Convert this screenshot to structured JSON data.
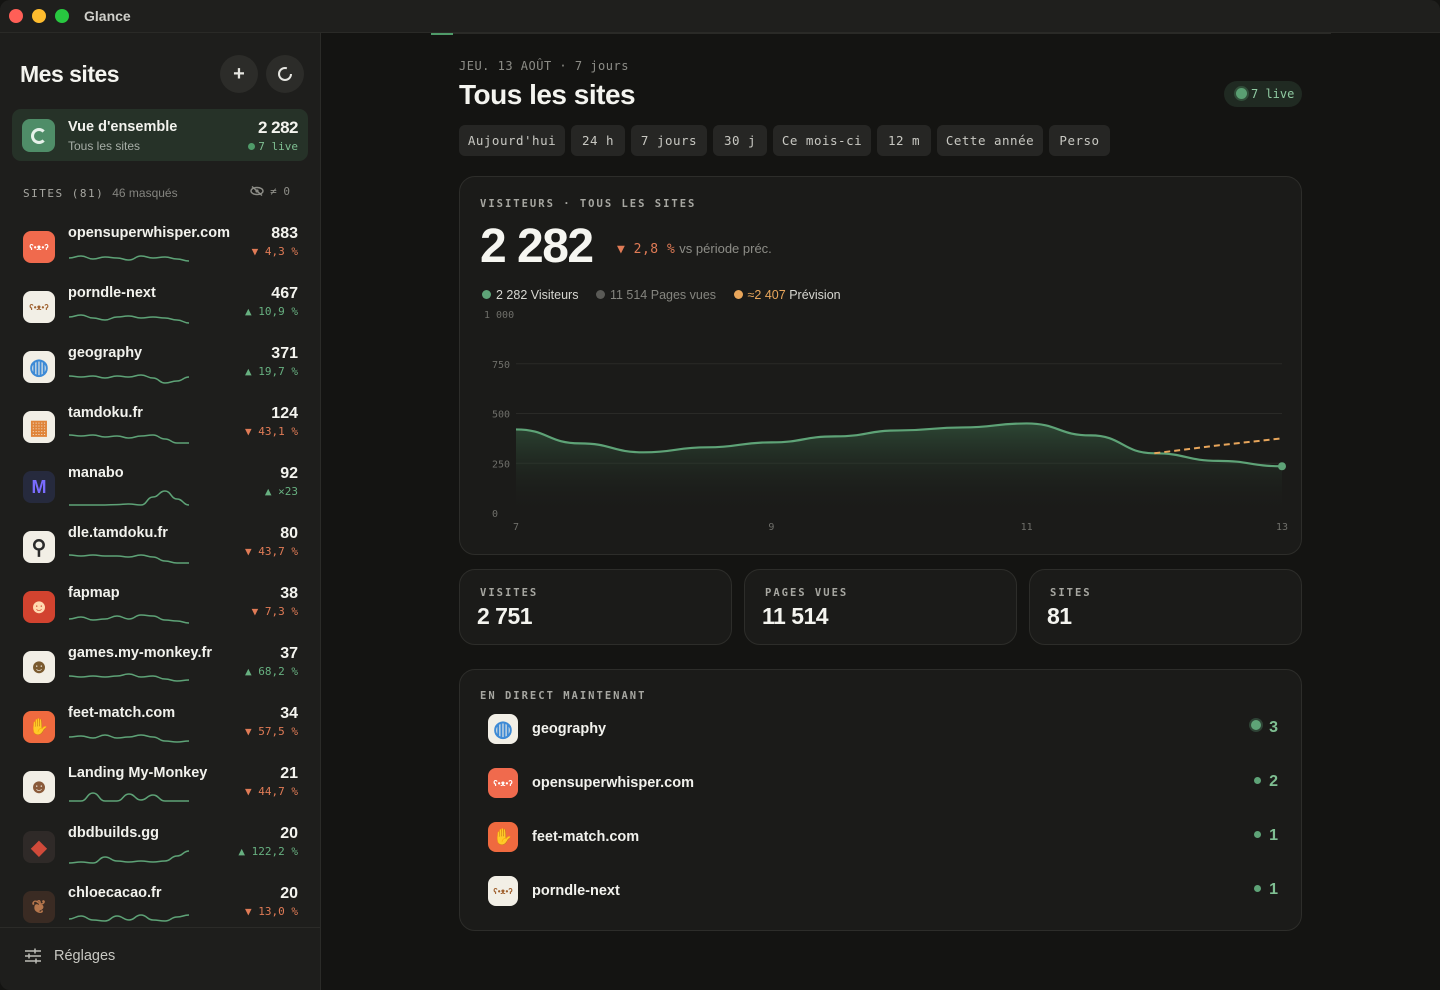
{
  "window": {
    "title": "Glance"
  },
  "sidebar": {
    "title": "Mes sites",
    "add_icon": "plus-icon",
    "refresh_icon": "refresh-icon",
    "overview": {
      "title": "Vue d'ensemble",
      "subtitle": "Tous les sites",
      "value": "2 282",
      "live": "7 live"
    },
    "sites_header": {
      "label": "SITES (81)",
      "hidden": "46 masqués",
      "filter": "≠ 0"
    },
    "sites": [
      {
        "name": "opensuperwhisper.com",
        "live": true,
        "value": "883",
        "delta": "▼ 4,3 %",
        "trend": "down",
        "icon": "bear-mic-icon",
        "icon_bg": "#f06a4d",
        "spark": [
          0.45,
          0.55,
          0.4,
          0.5,
          0.45,
          0.35,
          0.55,
          0.45,
          0.5,
          0.4,
          0.3
        ]
      },
      {
        "name": "porndle-next",
        "live": true,
        "value": "467",
        "delta": "▲ 10,9 %",
        "trend": "up",
        "icon": "bear-icon",
        "icon_bg": "#f2efe6",
        "spark": [
          0.5,
          0.6,
          0.45,
          0.35,
          0.5,
          0.55,
          0.45,
          0.5,
          0.45,
          0.35,
          0.2
        ]
      },
      {
        "name": "geography",
        "live": true,
        "value": "371",
        "delta": "▲ 19,7 %",
        "trend": "up",
        "icon": "globe-icon",
        "icon_bg": "#f2efe6",
        "spark": [
          0.55,
          0.5,
          0.55,
          0.45,
          0.55,
          0.5,
          0.6,
          0.45,
          0.2,
          0.3,
          0.5
        ]
      },
      {
        "name": "tamdoku.fr",
        "live": false,
        "value": "124",
        "delta": "▼ 43,1 %",
        "trend": "down",
        "icon": "grid-icon",
        "icon_bg": "#f2efe6",
        "spark": [
          0.6,
          0.55,
          0.6,
          0.5,
          0.55,
          0.45,
          0.55,
          0.6,
          0.4,
          0.2,
          0.2
        ]
      },
      {
        "name": "manabo",
        "live": false,
        "value": "92",
        "delta": "▲ ×23",
        "trend": "up",
        "icon": "m-letter-icon",
        "icon_bg": "#262a3d",
        "spark": [
          0.1,
          0.1,
          0.1,
          0.1,
          0.12,
          0.15,
          0.1,
          0.5,
          0.8,
          0.4,
          0.1
        ]
      },
      {
        "name": "dle.tamdoku.fr",
        "live": false,
        "value": "80",
        "delta": "▼ 43,7 %",
        "trend": "down",
        "icon": "magnifier-icon",
        "icon_bg": "#f2efe6",
        "spark": [
          0.6,
          0.55,
          0.6,
          0.55,
          0.55,
          0.5,
          0.6,
          0.5,
          0.3,
          0.2,
          0.2
        ]
      },
      {
        "name": "fapmap",
        "live": false,
        "value": "38",
        "delta": "▼ 7,3 %",
        "trend": "down",
        "icon": "monkey-red-icon",
        "icon_bg": "#d2432f",
        "spark": [
          0.4,
          0.5,
          0.35,
          0.4,
          0.55,
          0.4,
          0.6,
          0.55,
          0.35,
          0.3,
          0.2
        ]
      },
      {
        "name": "games.my-monkey.fr",
        "live": false,
        "value": "37",
        "delta": "▲ 68,2 %",
        "trend": "up",
        "icon": "monkey-face-icon",
        "icon_bg": "#f2efe6",
        "spark": [
          0.55,
          0.5,
          0.55,
          0.5,
          0.55,
          0.65,
          0.5,
          0.55,
          0.4,
          0.3,
          0.35
        ]
      },
      {
        "name": "feet-match.com",
        "live": true,
        "value": "34",
        "delta": "▼ 57,5 %",
        "trend": "down",
        "icon": "foot-icon",
        "icon_bg": "#ef6a3f",
        "spark": [
          0.5,
          0.55,
          0.45,
          0.6,
          0.45,
          0.5,
          0.6,
          0.5,
          0.3,
          0.25,
          0.3
        ]
      },
      {
        "name": "Landing My-Monkey",
        "live": false,
        "value": "21",
        "delta": "▼ 44,7 %",
        "trend": "down",
        "icon": "monkey-icon",
        "icon_bg": "#f2efe6",
        "spark": [
          0.3,
          0.3,
          0.7,
          0.3,
          0.3,
          0.65,
          0.35,
          0.6,
          0.3,
          0.3,
          0.3
        ]
      },
      {
        "name": "dbdbuilds.gg",
        "live": false,
        "value": "20",
        "delta": "▲ 122,2 %",
        "trend": "up",
        "icon": "diamond-icon",
        "icon_bg": "#2f2a28",
        "spark": [
          0.2,
          0.25,
          0.2,
          0.5,
          0.3,
          0.25,
          0.3,
          0.25,
          0.3,
          0.55,
          0.8
        ]
      },
      {
        "name": "chloecacao.fr",
        "live": false,
        "value": "20",
        "delta": "▼ 13,0 %",
        "trend": "down",
        "icon": "cacao-icon",
        "icon_bg": "#3a2b23",
        "spark": [
          0.4,
          0.55,
          0.35,
          0.3,
          0.55,
          0.35,
          0.6,
          0.35,
          0.3,
          0.5,
          0.6
        ]
      }
    ],
    "settings": {
      "label": "Réglages",
      "icon": "sliders-icon"
    }
  },
  "main": {
    "date_line": "JEU. 13 AOÛT · 7 jours",
    "title": "Tous les sites",
    "live_pill": "7 live",
    "tabs": [
      {
        "label": "Aujourd'hui",
        "active": false
      },
      {
        "label": "24 h",
        "active": false
      },
      {
        "label": "7 jours",
        "active": true
      },
      {
        "label": "30 j",
        "active": false
      },
      {
        "label": "Ce mois-ci",
        "active": false
      },
      {
        "label": "12 m",
        "active": false
      },
      {
        "label": "Cette année",
        "active": false
      },
      {
        "label": "Perso",
        "active": false
      }
    ],
    "visitors_card": {
      "label": "VISITEURS · TOUS LES SITES",
      "value": "2 282",
      "delta_pct": "▼ 2,8 %",
      "delta_text": "vs période préc.",
      "legend": {
        "visitors": "2 282 Visiteurs",
        "pageviews": "11 514 Pages vues",
        "forecast_value": "≈2 407",
        "forecast_label": "Prévision"
      }
    },
    "stats": [
      {
        "label": "VISITES",
        "value": "2 751"
      },
      {
        "label": "PAGES VUES",
        "value": "11 514"
      },
      {
        "label": "SITES",
        "value": "81"
      }
    ],
    "direct": {
      "label": "EN DIRECT MAINTENANT",
      "rows": [
        {
          "name": "geography",
          "count": "3",
          "icon": "globe-icon",
          "icon_bg": "#f2efe6"
        },
        {
          "name": "opensuperwhisper.com",
          "count": "2",
          "icon": "bear-mic-icon",
          "icon_bg": "#f06a4d"
        },
        {
          "name": "feet-match.com",
          "count": "1",
          "icon": "foot-icon",
          "icon_bg": "#ef6a3f"
        },
        {
          "name": "porndle-next",
          "count": "1",
          "icon": "bear-icon",
          "icon_bg": "#f2efe6"
        }
      ]
    }
  },
  "colors": {
    "accent": "#4f9b69",
    "down": "#e07b56",
    "up": "#67b080",
    "forecast": "#e8a65b"
  },
  "chart_data": {
    "type": "area",
    "x": [
      7,
      7.5,
      8,
      8.5,
      9,
      9.5,
      10,
      10.5,
      11,
      11.5,
      12,
      12.5,
      13
    ],
    "series": [
      {
        "name": "Visiteurs",
        "values": [
          420,
          350,
          305,
          330,
          355,
          385,
          415,
          430,
          450,
          390,
          300,
          262,
          235
        ]
      },
      {
        "name": "Prévision",
        "values": [
          null,
          null,
          null,
          null,
          null,
          null,
          null,
          null,
          null,
          null,
          300,
          340,
          375
        ]
      }
    ],
    "xticks": [
      "7",
      "9",
      "11",
      "13"
    ],
    "yticks": [
      "0",
      "250",
      "500",
      "750",
      "1 000"
    ],
    "ylim": [
      0,
      1000
    ],
    "grid": true
  }
}
